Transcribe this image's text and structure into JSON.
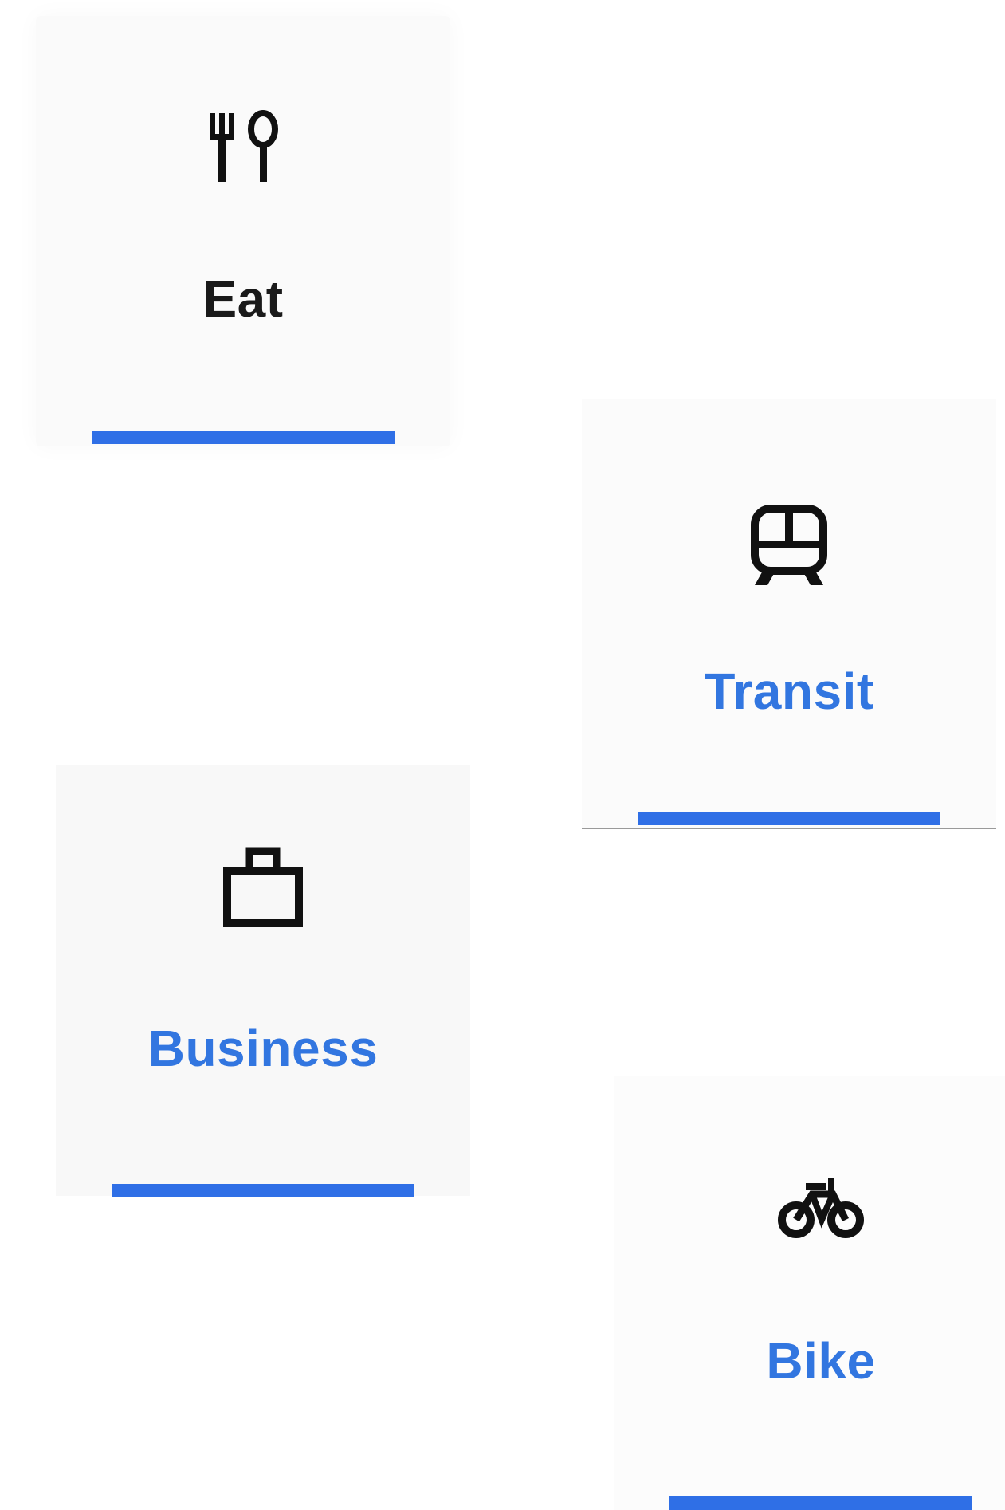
{
  "categories": [
    {
      "key": "eat",
      "label": "Eat",
      "icon": "fork-spoon-icon"
    },
    {
      "key": "transit",
      "label": "Transit",
      "icon": "train-icon"
    },
    {
      "key": "business",
      "label": "Business",
      "icon": "briefcase-icon"
    },
    {
      "key": "bike",
      "label": "Bike",
      "icon": "bicycle-icon"
    }
  ],
  "colors": {
    "accent": "#2f6fe6",
    "label_dark": "#1a1a1a",
    "label_blue": "#3276e0"
  }
}
